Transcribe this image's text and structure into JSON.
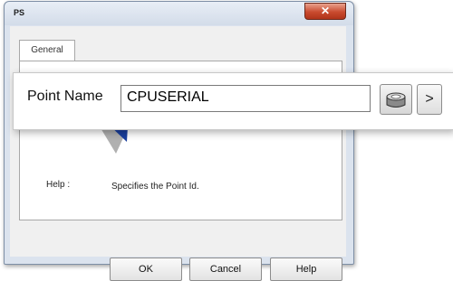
{
  "window": {
    "title": "PS",
    "close_glyph": "✕"
  },
  "tabs": [
    {
      "label": "General"
    }
  ],
  "help": {
    "label": "Help :",
    "text": "Specifies the Point Id."
  },
  "buttons": {
    "ok": "OK",
    "cancel": "Cancel",
    "help": "Help"
  },
  "callout": {
    "label": "Point Name",
    "value": "CPUSERIAL",
    "browse_icon": "hard-drive-icon",
    "next_glyph": ">"
  },
  "colors": {
    "pointer": "#1a3f9e",
    "pointer_shadow": "#8f8f8f",
    "close_button": "#c94a2e"
  }
}
